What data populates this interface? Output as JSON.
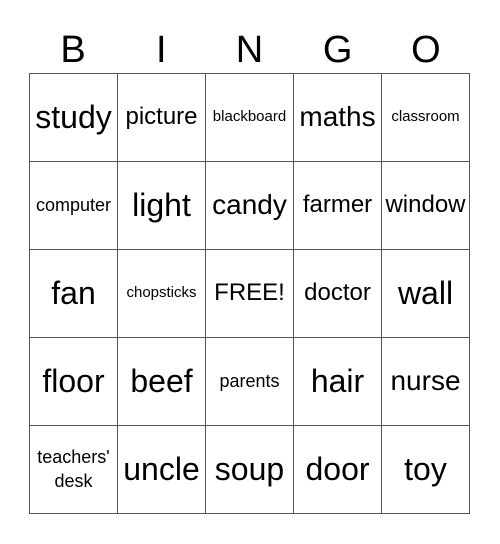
{
  "header": {
    "letters": [
      "B",
      "I",
      "N",
      "G",
      "O"
    ]
  },
  "card": {
    "rows": [
      [
        "study",
        "picture",
        "blackboard",
        "maths",
        "classroom"
      ],
      [
        "computer",
        "light",
        "candy",
        "farmer",
        "window"
      ],
      [
        "fan",
        "chopsticks",
        "FREE!",
        "doctor",
        "wall"
      ],
      [
        "floor",
        "beef",
        "parents",
        "hair",
        "nurse"
      ],
      [
        "teachers' desk",
        "uncle",
        "soup",
        "door",
        "toy"
      ]
    ]
  }
}
